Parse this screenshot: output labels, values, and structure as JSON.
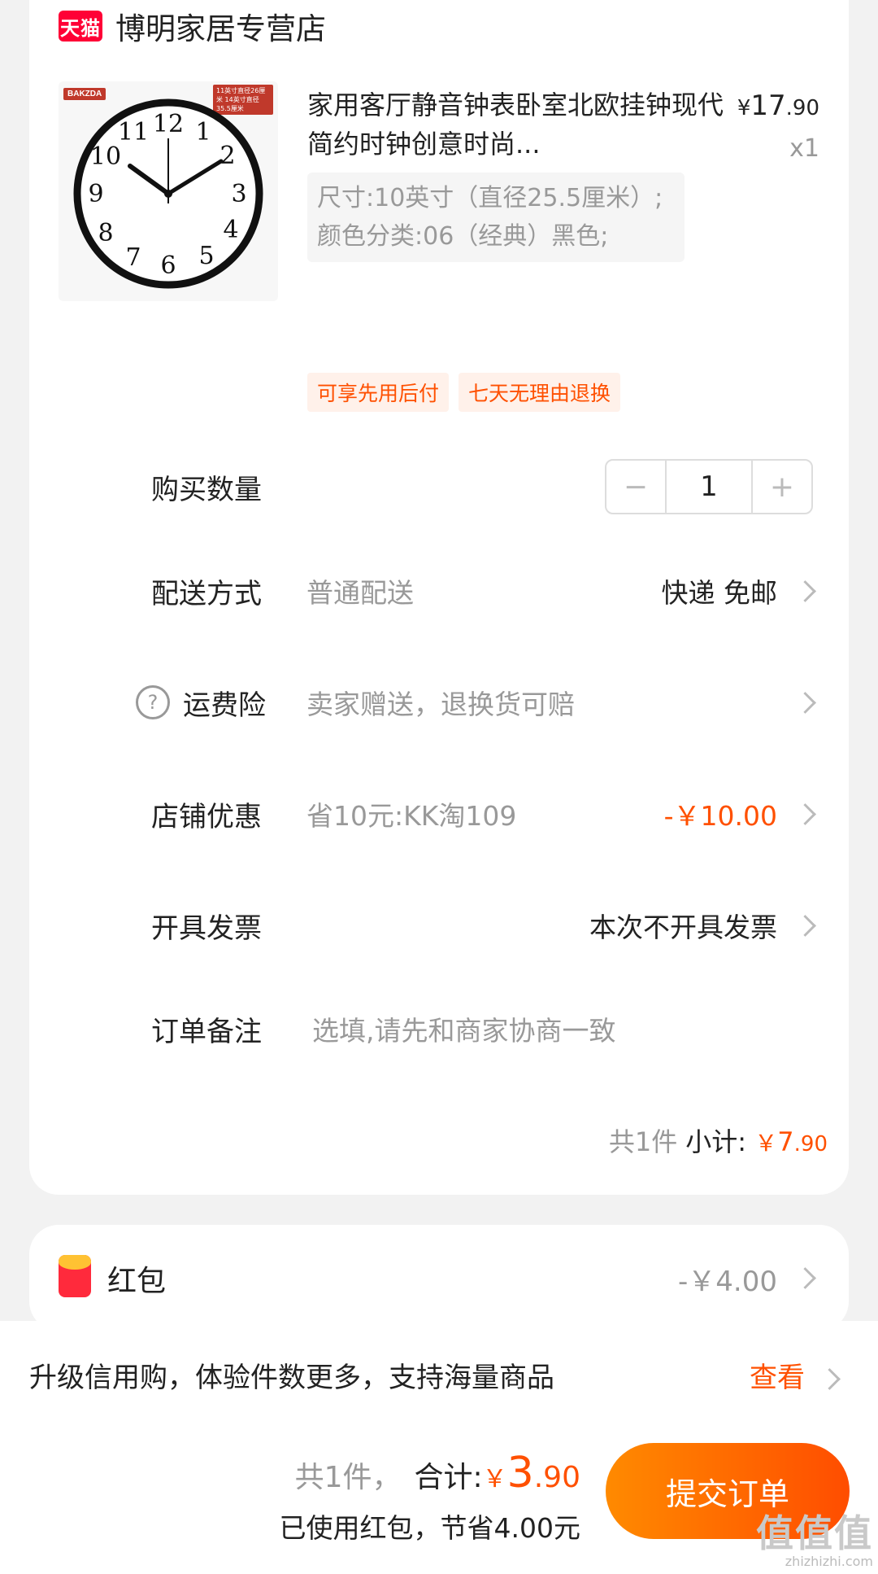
{
  "shop": {
    "badge": "天猫",
    "name": "博明家居专营店"
  },
  "product": {
    "image_brand": "BAKZDA",
    "image_size_note": "11英寸直径26厘米 14英寸直径35.5厘米",
    "title": "家用客厅静音钟表卧室北欧挂钟现代简约时钟创意时尚...",
    "price_symbol": "¥",
    "price_int": "17",
    "price_dec": ".90",
    "quantity_label": "x1",
    "sku": "尺寸:10英寸（直径25.5厘米）;颜色分类:06（经典）黑色;"
  },
  "tags": [
    "可享先用后付",
    "七天无理由退换"
  ],
  "rows": {
    "quantity": {
      "label": "购买数量",
      "minus": "−",
      "value": "1",
      "plus": "+"
    },
    "delivery": {
      "label": "配送方式",
      "sub": "普通配送",
      "value": "快递 免邮"
    },
    "insurance": {
      "icon_text": "?",
      "label": "运费险",
      "sub": "卖家赠送，退换货可赔"
    },
    "discount": {
      "label": "店铺优惠",
      "sub": "省10元:KK淘109",
      "value": "-￥10.00"
    },
    "invoice": {
      "label": "开具发票",
      "value": "本次不开具发票"
    },
    "remark": {
      "label": "订单备注",
      "placeholder": "选填,请先和商家协商一致"
    }
  },
  "subtotal": {
    "count": "共1件",
    "label": "小计:",
    "symbol": "￥",
    "int": "7",
    "dec": ".90"
  },
  "red_packet": {
    "label": "红包",
    "value": "-￥4.00"
  },
  "credit": {
    "text": "升级信用购，体验件数更多，支持海量商品",
    "link": "查看"
  },
  "footer": {
    "count": "共1件，",
    "total_label": "合计:",
    "symbol": "￥",
    "total_int": "3",
    "total_dec": ".90",
    "saved": "已使用红包，节省4.00元",
    "submit": "提交订单"
  },
  "watermark": {
    "brand": "值值值",
    "url": "zhizhizhi.com"
  },
  "colors": {
    "accent": "#ff5000",
    "tmall_red": "#ff0036",
    "muted": "#999999",
    "background": "#f2f2f2"
  }
}
